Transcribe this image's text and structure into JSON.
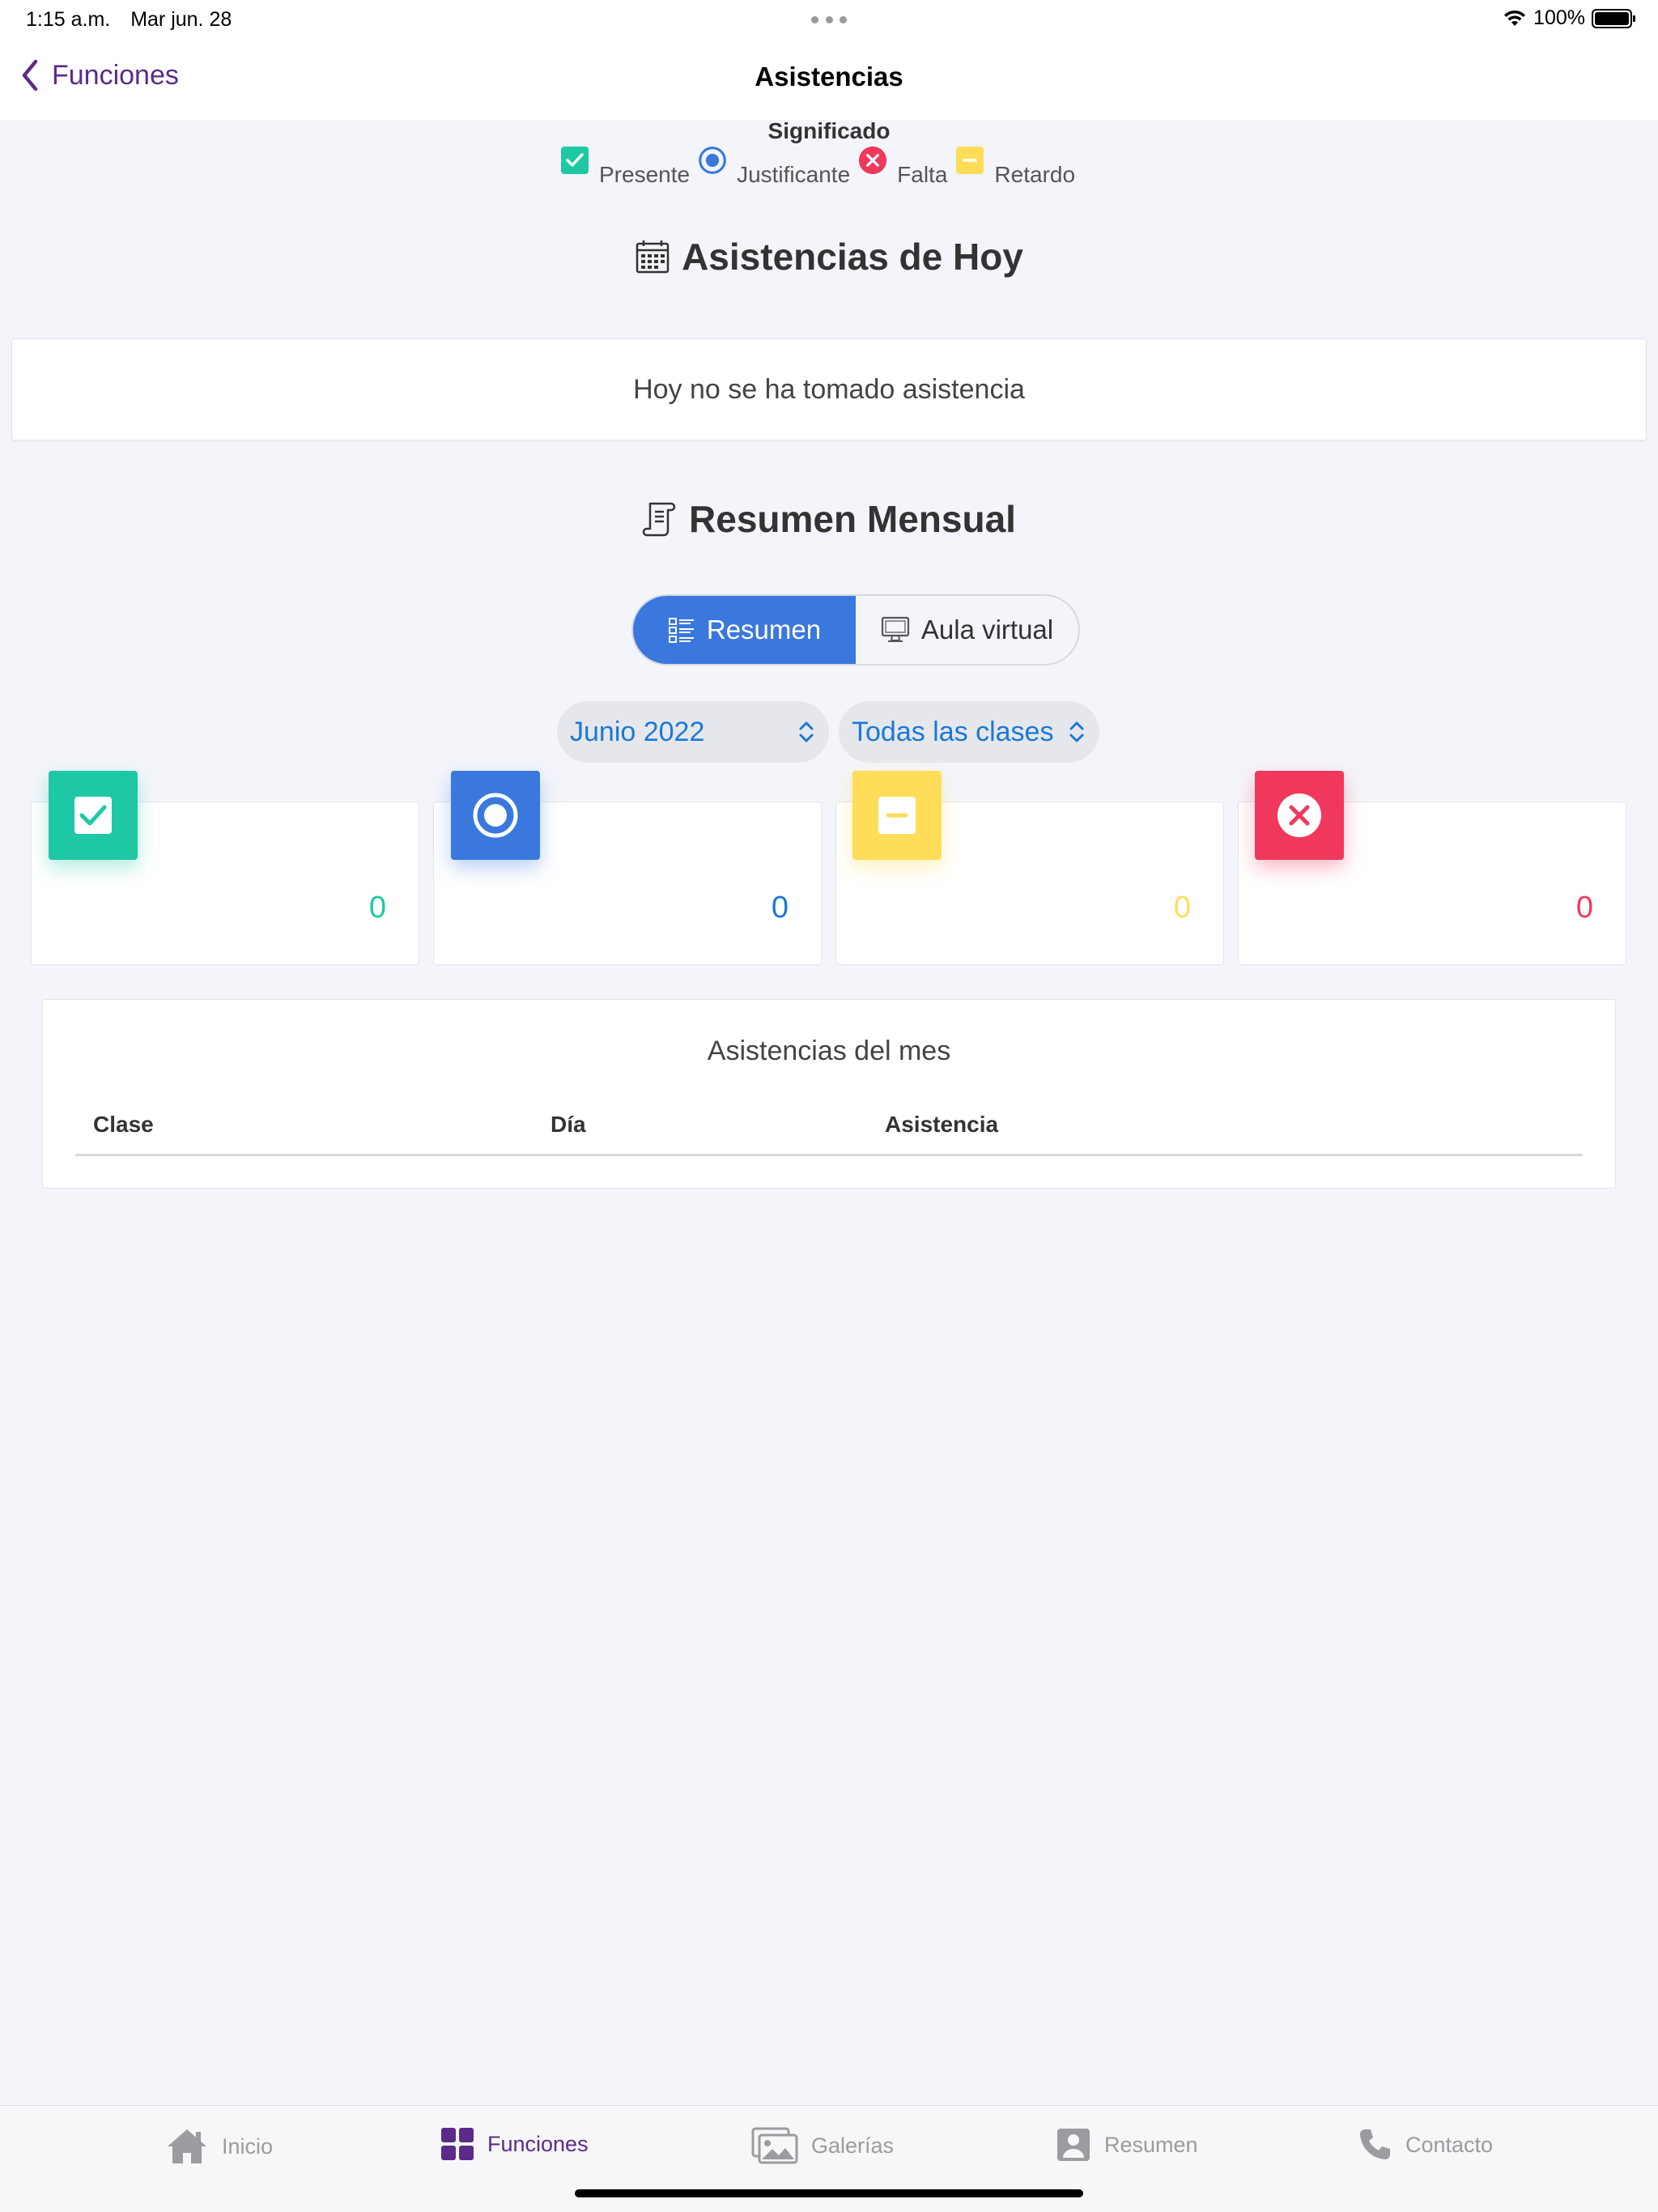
{
  "status": {
    "time": "1:15 a.m.",
    "date": "Mar jun. 28",
    "battery": "100%"
  },
  "nav": {
    "back_label": "Funciones",
    "title": "Asistencias"
  },
  "legend": {
    "title": "Significado",
    "items": [
      {
        "label": "Presente",
        "icon": "check-square-icon",
        "color": "#1ec8a5"
      },
      {
        "label": "Justificante",
        "icon": "radio-dot-icon",
        "color": "#3a78de"
      },
      {
        "label": "Falta",
        "icon": "x-circle-icon",
        "color": "#f0385d"
      },
      {
        "label": "Retardo",
        "icon": "minus-square-icon",
        "color": "#ffdd59"
      }
    ]
  },
  "today": {
    "title": "Asistencias de Hoy",
    "empty_message": "Hoy no se ha tomado asistencia"
  },
  "monthly": {
    "title": "Resumen Mensual",
    "segments": [
      {
        "label": "Resumen",
        "active": true
      },
      {
        "label": "Aula virtual",
        "active": false
      }
    ],
    "month_select": "Junio 2022",
    "class_select": "Todas las clases",
    "stats": [
      {
        "name": "presente",
        "value": "0",
        "color": "#1ec8a5"
      },
      {
        "name": "justificante",
        "value": "0",
        "color": "#3a78de"
      },
      {
        "name": "retardo",
        "value": "0",
        "color": "#ffdd59"
      },
      {
        "name": "falta",
        "value": "0",
        "color": "#f0385d"
      }
    ],
    "table": {
      "title": "Asistencias del mes",
      "headers": [
        "Clase",
        "Día",
        "Asistencia"
      ],
      "rows": []
    }
  },
  "tabbar": [
    {
      "label": "Inicio",
      "icon": "home-icon",
      "active": false
    },
    {
      "label": "Funciones",
      "icon": "grid-icon",
      "active": true
    },
    {
      "label": "Galerías",
      "icon": "images-icon",
      "active": false
    },
    {
      "label": "Resumen",
      "icon": "profile-icon",
      "active": false
    },
    {
      "label": "Contacto",
      "icon": "phone-icon",
      "active": false
    }
  ]
}
